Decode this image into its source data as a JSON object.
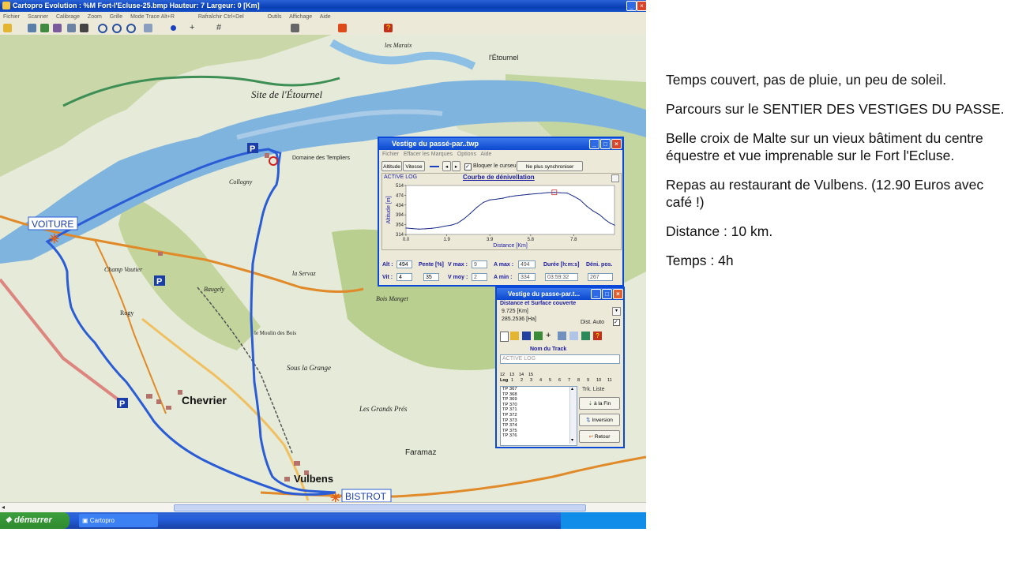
{
  "window": {
    "title": "Cartopro Evolution :  %M Fort-l'Ecluse-25.bmp   Hauteur: 7   Largeur: 0  [Km]",
    "menu": [
      "Fichier",
      "Scanner",
      "Calibrage",
      "Zoom",
      "Grille",
      "Mode Trace Alt+R",
      "Rafraîchir Ctrl+Del",
      "Outils",
      "Affichage",
      "Aide"
    ]
  },
  "map": {
    "labels": {
      "voiture": "VOITURE",
      "bistrot": "BISTROT",
      "site_etournel": "Site de l'Étournel",
      "chevrier": "Chevrier",
      "vulbens": "Vulbens",
      "sous_la_grange": "Sous la Grange",
      "grands_pres": "Les Grands Prés",
      "collogny": "Collogny",
      "etournel_small": "l'Étournel",
      "faramaz": "Faramaz",
      "champ_vautier": "Champ Vautier",
      "rogy": "Rogy",
      "baugely": "Baugely",
      "la_servaz": "la Servaz",
      "bois_manget": "Bois Manget",
      "moulin": "le Moulin des Bois",
      "templiers": "Domaine des Templiers",
      "les_maraix": "les Maraix"
    }
  },
  "elevation_window": {
    "title": "Vestige du passé-par..twp",
    "menu": [
      "Fichier",
      "Effacer les Marques",
      "Options",
      "Aide"
    ],
    "buttons": {
      "altitude": "Altitude",
      "vitesse": "Vitesse",
      "bloquer": "Bloquer le curseur",
      "sync": "Ne plus synchroniser"
    },
    "log_label": "ACTIVE LOG",
    "chart_title": "Courbe de dénivellation",
    "readouts": {
      "alt_label": "Alt :",
      "alt_value": "494",
      "pente_label": "Pente [%]",
      "pente_value": "35",
      "vmax_label": "V max :",
      "vmax_value": "9",
      "amax_label": "A max :",
      "amax_value": "494",
      "duree_label": "Durée [h:m:s]",
      "duree_value": "03:59:32",
      "deni_label": "Déni. pos.",
      "deni_value": "267",
      "vit_label": "Vit :",
      "vit_value": "4",
      "vmoy_label": "V moy :",
      "vmoy_value": "2",
      "amin_label": "A min :",
      "amin_value": "334"
    }
  },
  "chart_data": {
    "type": "line",
    "title": "Courbe de dénivellation",
    "xlabel": "Distance [Km]",
    "ylabel": "Altitude [m]",
    "xticks": [
      "0.0",
      "1.9",
      "3.9",
      "5.8",
      "7.8"
    ],
    "yticks": [
      "514",
      "474",
      "434",
      "394",
      "354",
      "314"
    ],
    "xlim": [
      0,
      9.7
    ],
    "ylim": [
      314,
      514
    ],
    "x": [
      0,
      0.3,
      0.6,
      0.9,
      1.2,
      1.5,
      1.8,
      2.1,
      2.4,
      2.7,
      3.0,
      3.3,
      3.6,
      3.9,
      4.2,
      4.5,
      4.8,
      5.1,
      5.4,
      5.7,
      6.0,
      6.3,
      6.6,
      6.9,
      7.2,
      7.5,
      7.8,
      8.1,
      8.4,
      8.7,
      9.0,
      9.3,
      9.5,
      9.7
    ],
    "values": [
      340,
      338,
      336,
      337,
      339,
      342,
      348,
      352,
      360,
      378,
      400,
      425,
      445,
      455,
      458,
      462,
      468,
      472,
      475,
      478,
      480,
      482,
      485,
      486,
      484,
      483,
      470,
      455,
      430,
      410,
      395,
      372,
      360,
      352
    ]
  },
  "track_window": {
    "title": "Vestige du passe-par.t...",
    "section_title": "Distance et Surface couverte",
    "distance": "9.725 [Km]",
    "surface": "285.2536 [Ha]",
    "dist_auto": "Dist. Auto",
    "nom_label": "Nom du Track",
    "track_name": "ACTIVE LOG",
    "tabs_top": [
      "12",
      "13",
      "14",
      "15"
    ],
    "tabs_bottom": [
      "Log",
      "1",
      "2",
      "3",
      "4",
      "5",
      "6",
      "7",
      "8",
      "9",
      "10",
      "11"
    ],
    "track_points": [
      "TP 367",
      "TP 368",
      "TP 369",
      "TP 370",
      "TP 371",
      "TP 372",
      "TP 373",
      "TP 374",
      "TP 375",
      "TP 376"
    ],
    "trk_liste": "Trk. Liste",
    "btn_fin": "à la Fin",
    "btn_inversion": "Inversion",
    "btn_retour": "Retour"
  },
  "taskbar": {
    "start": "démarrer",
    "task": "Cartopro"
  },
  "notes": [
    "Temps couvert, pas de pluie, un peu de soleil.",
    "Parcours sur le SENTIER DES VESTIGES DU PASSE.",
    "Belle croix de Malte sur un vieux bâtiment du centre équestre et vue imprenable sur le Fort l'Ecluse.",
    "Repas au restaurant de Vulbens. (12.90 Euros avec café !)",
    "Distance : 10 km.",
    "Temps : 4h"
  ]
}
